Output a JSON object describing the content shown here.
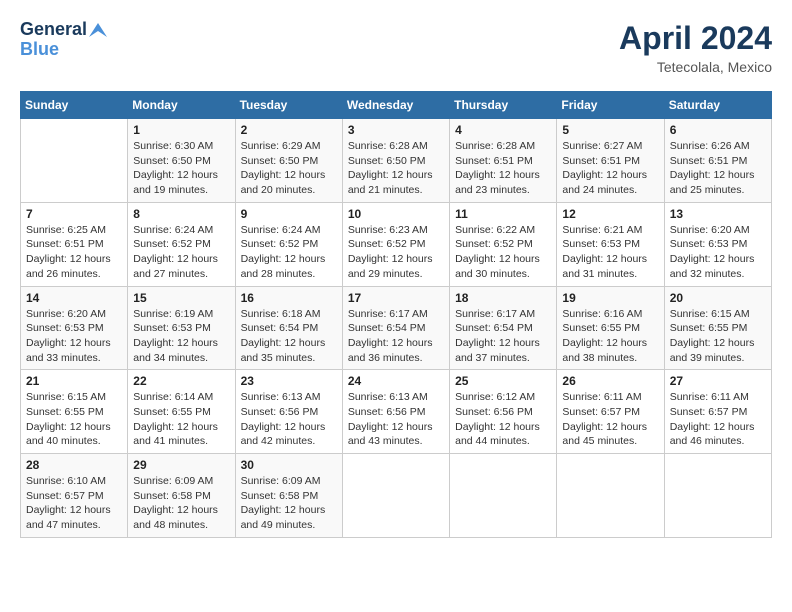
{
  "header": {
    "logo_line1": "General",
    "logo_line2": "Blue",
    "month_year": "April 2024",
    "location": "Tetecolala, Mexico"
  },
  "days_of_week": [
    "Sunday",
    "Monday",
    "Tuesday",
    "Wednesday",
    "Thursday",
    "Friday",
    "Saturday"
  ],
  "weeks": [
    [
      {
        "num": "",
        "info": ""
      },
      {
        "num": "1",
        "info": "Sunrise: 6:30 AM\nSunset: 6:50 PM\nDaylight: 12 hours\nand 19 minutes."
      },
      {
        "num": "2",
        "info": "Sunrise: 6:29 AM\nSunset: 6:50 PM\nDaylight: 12 hours\nand 20 minutes."
      },
      {
        "num": "3",
        "info": "Sunrise: 6:28 AM\nSunset: 6:50 PM\nDaylight: 12 hours\nand 21 minutes."
      },
      {
        "num": "4",
        "info": "Sunrise: 6:28 AM\nSunset: 6:51 PM\nDaylight: 12 hours\nand 23 minutes."
      },
      {
        "num": "5",
        "info": "Sunrise: 6:27 AM\nSunset: 6:51 PM\nDaylight: 12 hours\nand 24 minutes."
      },
      {
        "num": "6",
        "info": "Sunrise: 6:26 AM\nSunset: 6:51 PM\nDaylight: 12 hours\nand 25 minutes."
      }
    ],
    [
      {
        "num": "7",
        "info": "Sunrise: 6:25 AM\nSunset: 6:51 PM\nDaylight: 12 hours\nand 26 minutes."
      },
      {
        "num": "8",
        "info": "Sunrise: 6:24 AM\nSunset: 6:52 PM\nDaylight: 12 hours\nand 27 minutes."
      },
      {
        "num": "9",
        "info": "Sunrise: 6:24 AM\nSunset: 6:52 PM\nDaylight: 12 hours\nand 28 minutes."
      },
      {
        "num": "10",
        "info": "Sunrise: 6:23 AM\nSunset: 6:52 PM\nDaylight: 12 hours\nand 29 minutes."
      },
      {
        "num": "11",
        "info": "Sunrise: 6:22 AM\nSunset: 6:52 PM\nDaylight: 12 hours\nand 30 minutes."
      },
      {
        "num": "12",
        "info": "Sunrise: 6:21 AM\nSunset: 6:53 PM\nDaylight: 12 hours\nand 31 minutes."
      },
      {
        "num": "13",
        "info": "Sunrise: 6:20 AM\nSunset: 6:53 PM\nDaylight: 12 hours\nand 32 minutes."
      }
    ],
    [
      {
        "num": "14",
        "info": "Sunrise: 6:20 AM\nSunset: 6:53 PM\nDaylight: 12 hours\nand 33 minutes."
      },
      {
        "num": "15",
        "info": "Sunrise: 6:19 AM\nSunset: 6:53 PM\nDaylight: 12 hours\nand 34 minutes."
      },
      {
        "num": "16",
        "info": "Sunrise: 6:18 AM\nSunset: 6:54 PM\nDaylight: 12 hours\nand 35 minutes."
      },
      {
        "num": "17",
        "info": "Sunrise: 6:17 AM\nSunset: 6:54 PM\nDaylight: 12 hours\nand 36 minutes."
      },
      {
        "num": "18",
        "info": "Sunrise: 6:17 AM\nSunset: 6:54 PM\nDaylight: 12 hours\nand 37 minutes."
      },
      {
        "num": "19",
        "info": "Sunrise: 6:16 AM\nSunset: 6:55 PM\nDaylight: 12 hours\nand 38 minutes."
      },
      {
        "num": "20",
        "info": "Sunrise: 6:15 AM\nSunset: 6:55 PM\nDaylight: 12 hours\nand 39 minutes."
      }
    ],
    [
      {
        "num": "21",
        "info": "Sunrise: 6:15 AM\nSunset: 6:55 PM\nDaylight: 12 hours\nand 40 minutes."
      },
      {
        "num": "22",
        "info": "Sunrise: 6:14 AM\nSunset: 6:55 PM\nDaylight: 12 hours\nand 41 minutes."
      },
      {
        "num": "23",
        "info": "Sunrise: 6:13 AM\nSunset: 6:56 PM\nDaylight: 12 hours\nand 42 minutes."
      },
      {
        "num": "24",
        "info": "Sunrise: 6:13 AM\nSunset: 6:56 PM\nDaylight: 12 hours\nand 43 minutes."
      },
      {
        "num": "25",
        "info": "Sunrise: 6:12 AM\nSunset: 6:56 PM\nDaylight: 12 hours\nand 44 minutes."
      },
      {
        "num": "26",
        "info": "Sunrise: 6:11 AM\nSunset: 6:57 PM\nDaylight: 12 hours\nand 45 minutes."
      },
      {
        "num": "27",
        "info": "Sunrise: 6:11 AM\nSunset: 6:57 PM\nDaylight: 12 hours\nand 46 minutes."
      }
    ],
    [
      {
        "num": "28",
        "info": "Sunrise: 6:10 AM\nSunset: 6:57 PM\nDaylight: 12 hours\nand 47 minutes."
      },
      {
        "num": "29",
        "info": "Sunrise: 6:09 AM\nSunset: 6:58 PM\nDaylight: 12 hours\nand 48 minutes."
      },
      {
        "num": "30",
        "info": "Sunrise: 6:09 AM\nSunset: 6:58 PM\nDaylight: 12 hours\nand 49 minutes."
      },
      {
        "num": "",
        "info": ""
      },
      {
        "num": "",
        "info": ""
      },
      {
        "num": "",
        "info": ""
      },
      {
        "num": "",
        "info": ""
      }
    ]
  ]
}
